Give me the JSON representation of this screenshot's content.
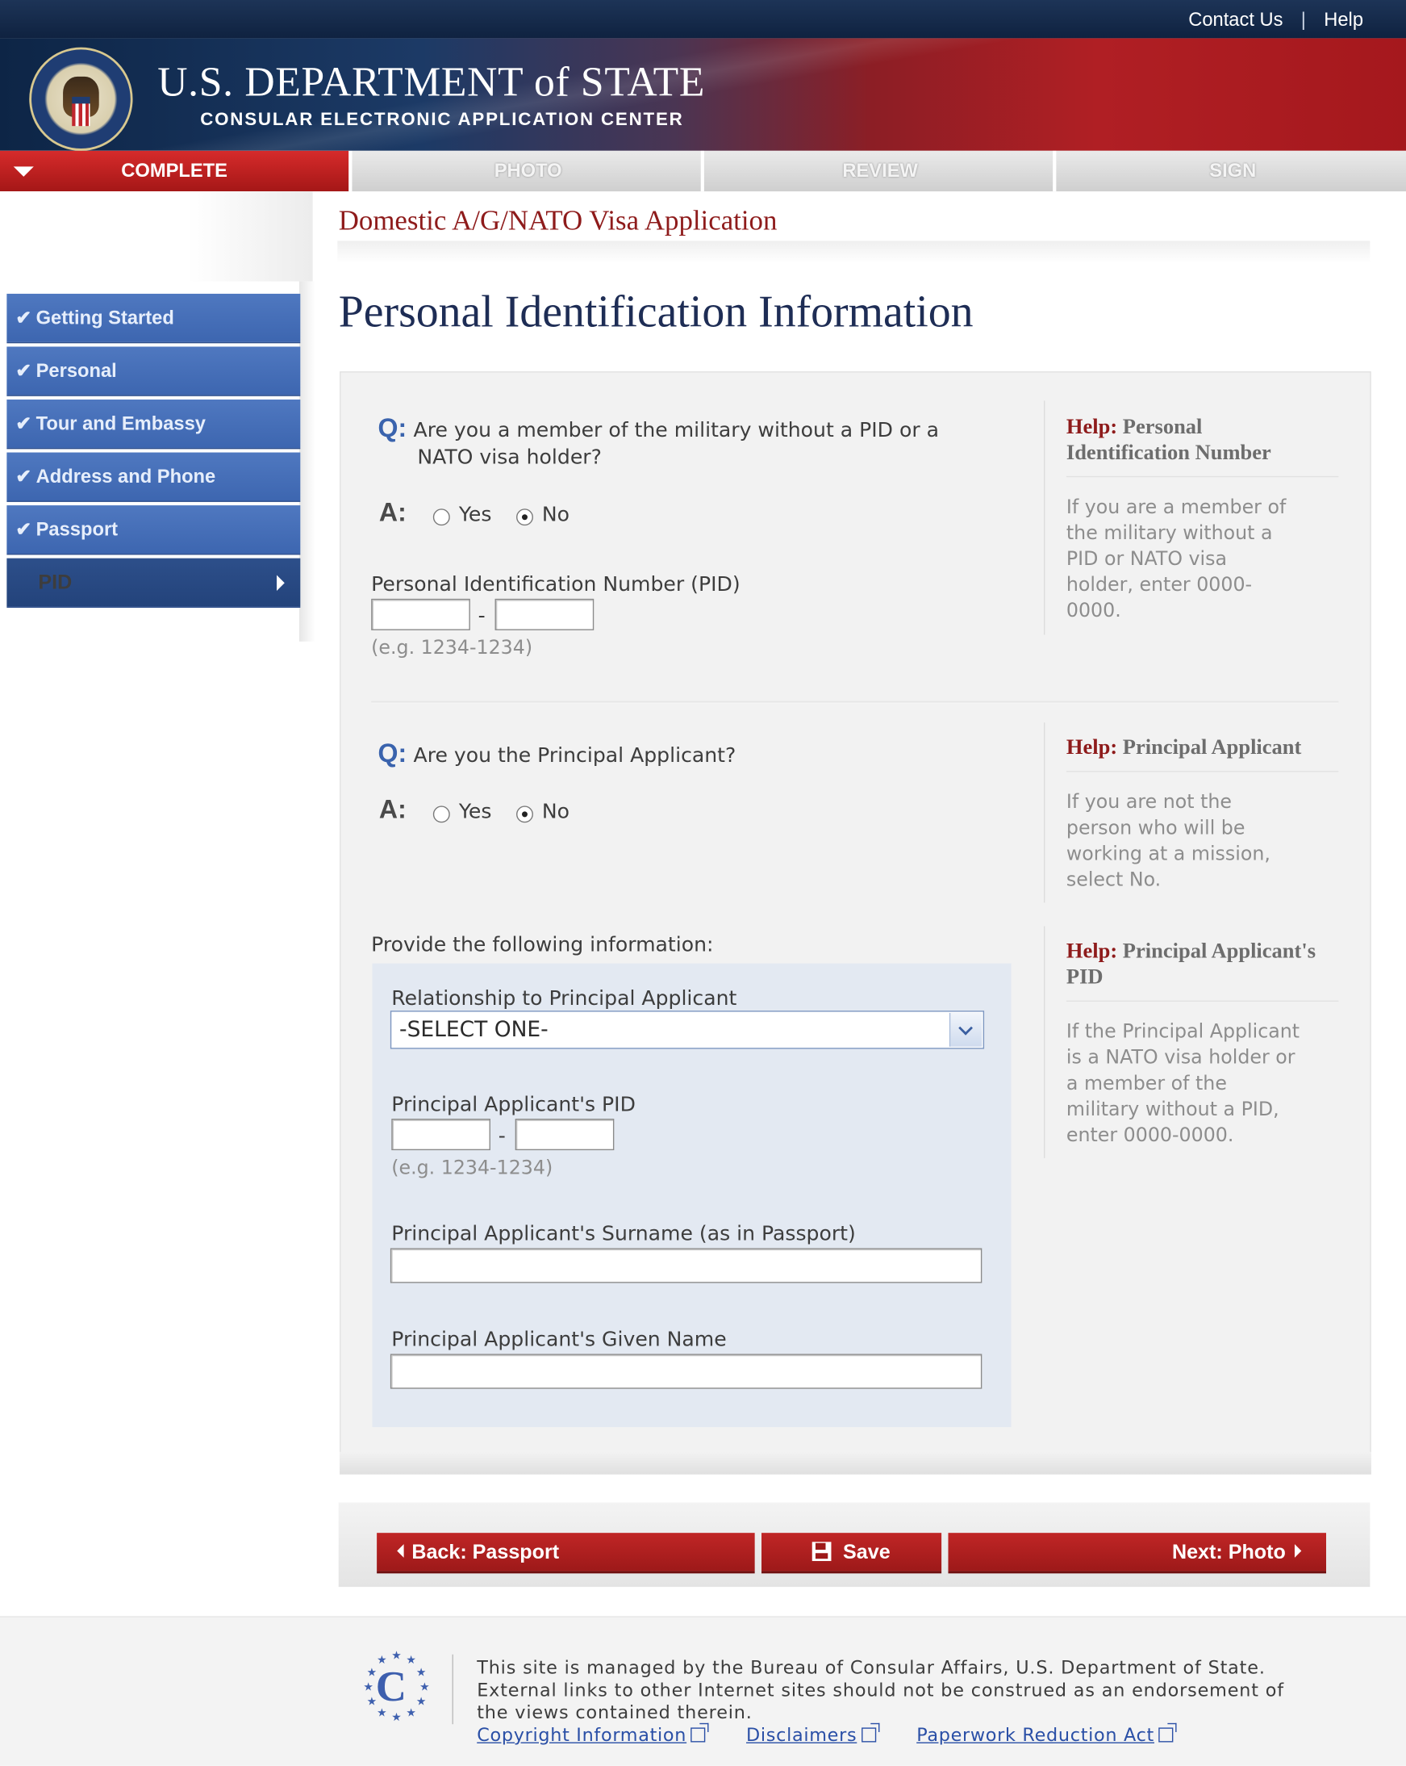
{
  "header": {
    "links": [
      "Contact Us",
      "Help"
    ],
    "title": "U.S. DEPARTMENT of STATE",
    "subtitle": "CONSULAR ELECTRONIC APPLICATION CENTER"
  },
  "tabs": [
    {
      "label": "COMPLETE",
      "active": true
    },
    {
      "label": "PHOTO",
      "active": false
    },
    {
      "label": "REVIEW",
      "active": false
    },
    {
      "label": "SIGN",
      "active": false
    }
  ],
  "sidebar": {
    "items": [
      {
        "label": "Getting Started",
        "done": true
      },
      {
        "label": "Personal",
        "done": true
      },
      {
        "label": "Tour and Embassy",
        "done": true
      },
      {
        "label": "Address and Phone",
        "done": true
      },
      {
        "label": "Passport",
        "done": true
      },
      {
        "label": "PID",
        "done": false,
        "current": true
      }
    ]
  },
  "main": {
    "app_title": "Domestic A/G/NATO Visa Application",
    "page_title": "Personal Identification Information",
    "q_marker": "Q:",
    "a_marker": "A:",
    "q1": {
      "line1": "Are you a member of the military without a PID or a",
      "line2": "NATO visa holder?",
      "yes": "Yes",
      "no": "No",
      "selected": "No"
    },
    "pid_label": "Personal Identification Number (PID)",
    "pid_separator": "-",
    "pid_example": "(e.g. 1234-1234)",
    "q2": {
      "text": "Are you the Principal Applicant?",
      "yes": "Yes",
      "no": "No",
      "selected": "No"
    },
    "provide_label": "Provide the following information:",
    "relationship_label": "Relationship to Principal Applicant",
    "relationship_value": "-SELECT ONE-",
    "pa_pid_label": "Principal Applicant's PID",
    "pa_pid_example": "(e.g. 1234-1234)",
    "pa_surname_label": "Principal Applicant's Surname (as in Passport)",
    "pa_given_label": "Principal Applicant's Given Name"
  },
  "help": {
    "prefix": "Help:",
    "h1": {
      "title_line1": "Personal",
      "title_line2": "Identification Number",
      "line1": "If you are a member of",
      "line2": "the military without a",
      "line3": "PID or NATO visa",
      "line4": "holder, enter 0000-",
      "line5": "0000."
    },
    "h2": {
      "title": "Principal Applicant",
      "line1": "If you are not the",
      "line2": "person who will be",
      "line3": "working at a mission,",
      "line4": "select No."
    },
    "h3": {
      "title_line1": "Principal Applicant's",
      "title_line2": "PID",
      "line1": "If the Principal Applicant",
      "line2": "is a NATO visa holder or",
      "line3": "a member of the",
      "line4": "military without a PID,",
      "line5": "enter 0000-0000."
    }
  },
  "buttons": {
    "back": "Back: Passport",
    "save": "Save",
    "next": "Next: Photo"
  },
  "footer": {
    "logo_letter": "C",
    "line1": "This site is managed by the Bureau of Consular Affairs, U.S. Department of State.",
    "line2": "External links to other Internet sites should not be construed as an endorsement of",
    "line3": "the views contained therein.",
    "links": [
      "Copyright Information",
      "Disclaimers",
      "Paperwork Reduction Act"
    ]
  },
  "colors": {
    "tab_active": "#c02626",
    "nav_blue": "#4f78c0",
    "title_red": "#8e1b1b",
    "q_blue": "#3a63ad",
    "button_red": "#9d1919"
  }
}
